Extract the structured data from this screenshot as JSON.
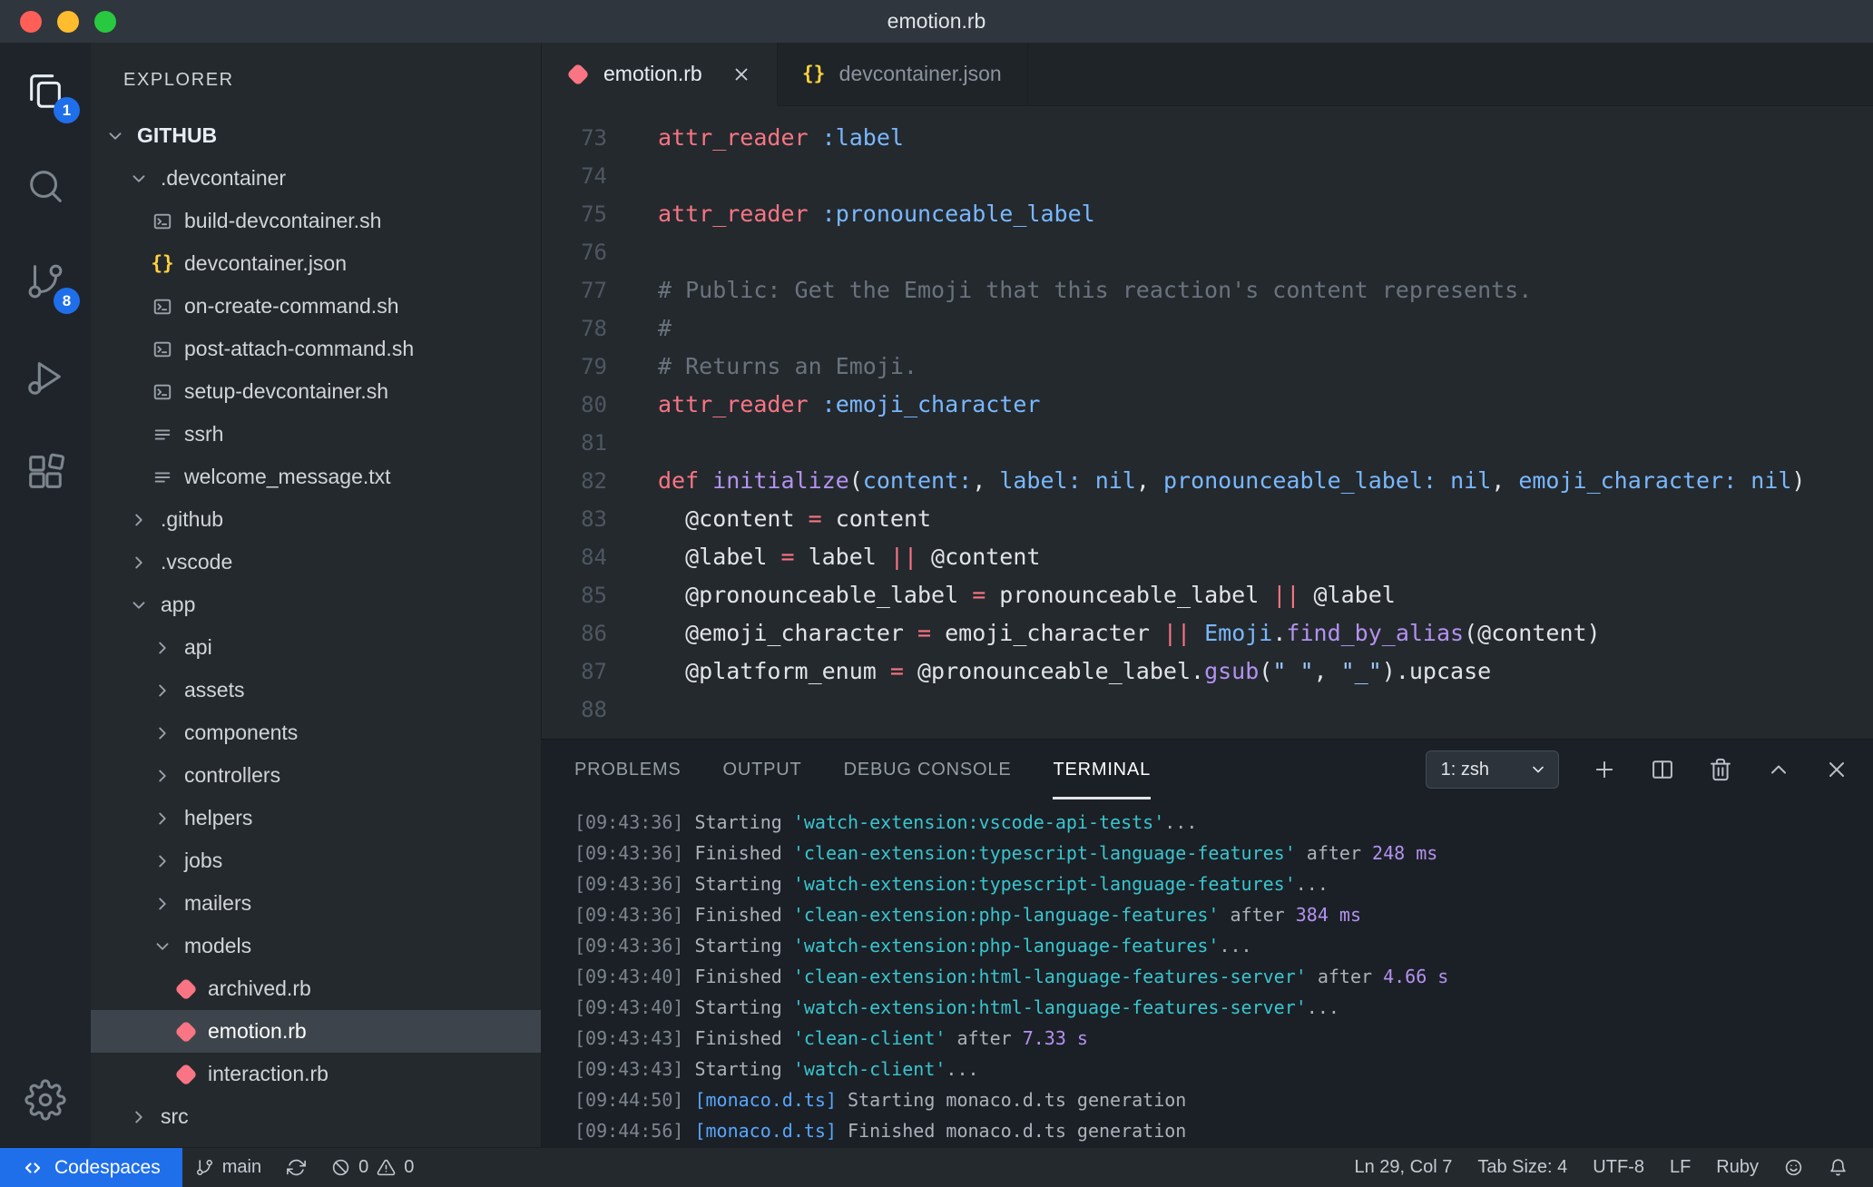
{
  "window": {
    "title": "emotion.rb"
  },
  "colors": {
    "accent_blue": "#1f6feb",
    "ruby_icon": "#f97583",
    "json_icon": "#ffd33d",
    "keyword": "#f97583",
    "constant": "#79b8ff",
    "function": "#b392f0",
    "comment": "#6a737d",
    "string": "#9ecbff",
    "foreground": "#e1e4e8",
    "terminal_cyan": "#39c5cf",
    "terminal_magenta": "#b392f0",
    "terminal_blue": "#58a6ff"
  },
  "activity_bar": {
    "items": [
      {
        "name": "explorer",
        "icon": "files",
        "badge": "1",
        "active": true
      },
      {
        "name": "search",
        "icon": "search"
      },
      {
        "name": "source-control",
        "icon": "branch",
        "badge": "8"
      },
      {
        "name": "run-debug",
        "icon": "debug"
      },
      {
        "name": "extensions",
        "icon": "extensions"
      }
    ]
  },
  "sidebar": {
    "header": "EXPLORER",
    "tree": [
      {
        "level": 0,
        "kind": "root",
        "label": "GITHUB",
        "expanded": true
      },
      {
        "level": 1,
        "kind": "folder",
        "label": ".devcontainer",
        "expanded": true
      },
      {
        "level": 2,
        "kind": "file",
        "icon": "shell",
        "label": "build-devcontainer.sh"
      },
      {
        "level": 2,
        "kind": "file",
        "icon": "json",
        "label": "devcontainer.json"
      },
      {
        "level": 2,
        "kind": "file",
        "icon": "shell",
        "label": "on-create-command.sh"
      },
      {
        "level": 2,
        "kind": "file",
        "icon": "shell",
        "label": "post-attach-command.sh"
      },
      {
        "level": 2,
        "kind": "file",
        "icon": "shell",
        "label": "setup-devcontainer.sh"
      },
      {
        "level": 2,
        "kind": "file",
        "icon": "list",
        "label": "ssrh"
      },
      {
        "level": 2,
        "kind": "file",
        "icon": "list",
        "label": "welcome_message.txt"
      },
      {
        "level": 1,
        "kind": "folder",
        "label": ".github",
        "expanded": false
      },
      {
        "level": 1,
        "kind": "folder",
        "label": ".vscode",
        "expanded": false
      },
      {
        "level": 1,
        "kind": "folder",
        "label": "app",
        "expanded": true
      },
      {
        "level": 2,
        "kind": "folder",
        "label": "api",
        "expanded": false
      },
      {
        "level": 2,
        "kind": "folder",
        "label": "assets",
        "expanded": false
      },
      {
        "level": 2,
        "kind": "folder",
        "label": "components",
        "expanded": false
      },
      {
        "level": 2,
        "kind": "folder",
        "label": "controllers",
        "expanded": false
      },
      {
        "level": 2,
        "kind": "folder",
        "label": "helpers",
        "expanded": false
      },
      {
        "level": 2,
        "kind": "folder",
        "label": "jobs",
        "expanded": false
      },
      {
        "level": 2,
        "kind": "folder",
        "label": "mailers",
        "expanded": false
      },
      {
        "level": 2,
        "kind": "folder",
        "label": "models",
        "expanded": true
      },
      {
        "level": 3,
        "kind": "file",
        "icon": "ruby",
        "label": "archived.rb"
      },
      {
        "level": 3,
        "kind": "file",
        "icon": "ruby",
        "label": "emotion.rb",
        "selected": true
      },
      {
        "level": 3,
        "kind": "file",
        "icon": "ruby",
        "label": "interaction.rb"
      },
      {
        "level": 1,
        "kind": "folder",
        "label": "src",
        "expanded": false
      }
    ]
  },
  "editor": {
    "tabs": [
      {
        "label": "emotion.rb",
        "icon": "ruby",
        "active": true,
        "closable": true
      },
      {
        "label": "devcontainer.json",
        "icon": "json",
        "active": false,
        "closable": false
      }
    ],
    "lines": [
      {
        "n": 73,
        "s": [
          [
            "k",
            "attr_reader"
          ],
          [
            "p",
            " "
          ],
          [
            "v",
            ":label"
          ]
        ]
      },
      {
        "n": 74,
        "s": []
      },
      {
        "n": 75,
        "s": [
          [
            "k",
            "attr_reader"
          ],
          [
            "p",
            " "
          ],
          [
            "v",
            ":pronounceable_label"
          ]
        ]
      },
      {
        "n": 76,
        "s": []
      },
      {
        "n": 77,
        "s": [
          [
            "c",
            "# Public: Get the Emoji that this reaction's content represents."
          ]
        ]
      },
      {
        "n": 78,
        "s": [
          [
            "c",
            "#"
          ]
        ]
      },
      {
        "n": 79,
        "s": [
          [
            "c",
            "# Returns an Emoji."
          ]
        ]
      },
      {
        "n": 80,
        "s": [
          [
            "k",
            "attr_reader"
          ],
          [
            "p",
            " "
          ],
          [
            "v",
            ":emoji_character"
          ]
        ]
      },
      {
        "n": 81,
        "s": []
      },
      {
        "n": 82,
        "s": [
          [
            "k",
            "def"
          ],
          [
            "p",
            " "
          ],
          [
            "f",
            "initialize"
          ],
          [
            "p",
            "("
          ],
          [
            "v",
            "content:"
          ],
          [
            "p",
            ", "
          ],
          [
            "v",
            "label:"
          ],
          [
            "p",
            " "
          ],
          [
            "v",
            "nil"
          ],
          [
            "p",
            ", "
          ],
          [
            "v",
            "pronounceable_label:"
          ],
          [
            "p",
            " "
          ],
          [
            "v",
            "nil"
          ],
          [
            "p",
            ", "
          ],
          [
            "v",
            "emoji_character:"
          ],
          [
            "p",
            " "
          ],
          [
            "v",
            "nil"
          ],
          [
            "p",
            ")"
          ]
        ]
      },
      {
        "n": 83,
        "s": [
          [
            "p",
            "  @content "
          ],
          [
            "k",
            "="
          ],
          [
            "p",
            " content"
          ]
        ]
      },
      {
        "n": 84,
        "s": [
          [
            "p",
            "  @label "
          ],
          [
            "k",
            "="
          ],
          [
            "p",
            " label "
          ],
          [
            "k",
            "||"
          ],
          [
            "p",
            " @content"
          ]
        ]
      },
      {
        "n": 85,
        "s": [
          [
            "p",
            "  @pronounceable_label "
          ],
          [
            "k",
            "="
          ],
          [
            "p",
            " pronounceable_label "
          ],
          [
            "k",
            "||"
          ],
          [
            "p",
            " @label"
          ]
        ]
      },
      {
        "n": 86,
        "s": [
          [
            "p",
            "  @emoji_character "
          ],
          [
            "k",
            "="
          ],
          [
            "p",
            " emoji_character "
          ],
          [
            "k",
            "||"
          ],
          [
            "p",
            " "
          ],
          [
            "v",
            "Emoji"
          ],
          [
            "p",
            "."
          ],
          [
            "f",
            "find_by_alias"
          ],
          [
            "p",
            "(@content)"
          ]
        ]
      },
      {
        "n": 87,
        "s": [
          [
            "p",
            "  @platform_enum "
          ],
          [
            "k",
            "="
          ],
          [
            "p",
            " @pronounceable_label."
          ],
          [
            "f",
            "gsub"
          ],
          [
            "p",
            "("
          ],
          [
            "s",
            "\" \""
          ],
          [
            "p",
            ", "
          ],
          [
            "s",
            "\"_\""
          ],
          [
            "p",
            ").upcase"
          ]
        ]
      },
      {
        "n": 88,
        "s": []
      }
    ]
  },
  "panel": {
    "tabs": [
      {
        "label": "PROBLEMS"
      },
      {
        "label": "OUTPUT"
      },
      {
        "label": "DEBUG CONSOLE"
      },
      {
        "label": "TERMINAL",
        "active": true
      }
    ],
    "shell_selector": "1: zsh",
    "terminal_lines": [
      {
        "time": "[09:43:36]",
        "segs": [
          [
            "w",
            " Starting "
          ],
          [
            "c",
            "'watch-extension:vscode-api-tests'"
          ],
          [
            "w",
            "..."
          ]
        ]
      },
      {
        "time": "[09:43:36]",
        "segs": [
          [
            "w",
            " Finished "
          ],
          [
            "c",
            "'clean-extension:typescript-language-features'"
          ],
          [
            "w",
            " after "
          ],
          [
            "m",
            "248 ms"
          ]
        ]
      },
      {
        "time": "[09:43:36]",
        "segs": [
          [
            "w",
            " Starting "
          ],
          [
            "c",
            "'watch-extension:typescript-language-features'"
          ],
          [
            "w",
            "..."
          ]
        ]
      },
      {
        "time": "[09:43:36]",
        "segs": [
          [
            "w",
            " Finished "
          ],
          [
            "c",
            "'clean-extension:php-language-features'"
          ],
          [
            "w",
            " after "
          ],
          [
            "m",
            "384 ms"
          ]
        ]
      },
      {
        "time": "[09:43:36]",
        "segs": [
          [
            "w",
            " Starting "
          ],
          [
            "c",
            "'watch-extension:php-language-features'"
          ],
          [
            "w",
            "..."
          ]
        ]
      },
      {
        "time": "[09:43:40]",
        "segs": [
          [
            "w",
            " Finished "
          ],
          [
            "c",
            "'clean-extension:html-language-features-server'"
          ],
          [
            "w",
            " after "
          ],
          [
            "m",
            "4.66 s"
          ]
        ]
      },
      {
        "time": "[09:43:40]",
        "segs": [
          [
            "w",
            " Starting "
          ],
          [
            "c",
            "'watch-extension:html-language-features-server'"
          ],
          [
            "w",
            "..."
          ]
        ]
      },
      {
        "time": "[09:43:43]",
        "segs": [
          [
            "w",
            " Finished "
          ],
          [
            "c",
            "'clean-client'"
          ],
          [
            "w",
            " after "
          ],
          [
            "m",
            "7.33 s"
          ]
        ]
      },
      {
        "time": "[09:43:43]",
        "segs": [
          [
            "w",
            " Starting "
          ],
          [
            "c",
            "'watch-client'"
          ],
          [
            "w",
            "..."
          ]
        ]
      },
      {
        "time": "[09:44:50]",
        "segs": [
          [
            "w",
            " "
          ],
          [
            "b",
            "[monaco.d.ts]"
          ],
          [
            "w",
            " Starting monaco.d.ts generation"
          ]
        ]
      },
      {
        "time": "[09:44:56]",
        "segs": [
          [
            "w",
            " "
          ],
          [
            "b",
            "[monaco.d.ts]"
          ],
          [
            "w",
            " Finished monaco.d.ts generation"
          ]
        ]
      }
    ]
  },
  "status_bar": {
    "codespaces": "Codespaces",
    "branch": "main",
    "errors": "0",
    "warnings": "0",
    "cursor": "Ln 29, Col 7",
    "tab_size": "Tab Size: 4",
    "encoding": "UTF-8",
    "eol": "LF",
    "language": "Ruby"
  }
}
